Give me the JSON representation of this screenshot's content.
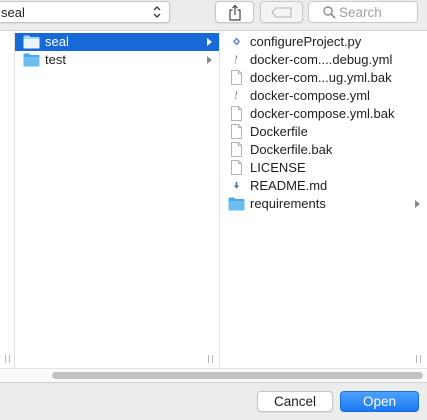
{
  "toolbar": {
    "path_popup_value": "seal",
    "share_icon": "share-icon",
    "tag_icon": "tag-icon",
    "search_placeholder": "Search"
  },
  "column2": {
    "items": [
      {
        "name": "seal",
        "kind": "folder",
        "selected": true,
        "has_children": true
      },
      {
        "name": "test",
        "kind": "folder",
        "selected": false,
        "has_children": true
      }
    ]
  },
  "column3": {
    "items": [
      {
        "name": "configureProject.py",
        "icon": "python-file-icon"
      },
      {
        "name": "docker-com....debug.yml",
        "icon": "yaml-file-icon"
      },
      {
        "name": "docker-com...ug.yml.bak",
        "icon": "document-icon"
      },
      {
        "name": "docker-compose.yml",
        "icon": "yaml-file-icon"
      },
      {
        "name": "docker-compose.yml.bak",
        "icon": "document-icon"
      },
      {
        "name": "Dockerfile",
        "icon": "document-icon"
      },
      {
        "name": "Dockerfile.bak",
        "icon": "document-icon"
      },
      {
        "name": "LICENSE",
        "icon": "document-icon"
      },
      {
        "name": "README.md",
        "icon": "markdown-file-icon"
      },
      {
        "name": "requirements",
        "icon": "folder-icon",
        "has_children": true
      }
    ]
  },
  "buttons": {
    "cancel_label": "Cancel",
    "open_label": "Open"
  },
  "colors": {
    "selection": "#1869d8",
    "folder": "#59b3ee",
    "primary_button": "#1a78f2"
  }
}
